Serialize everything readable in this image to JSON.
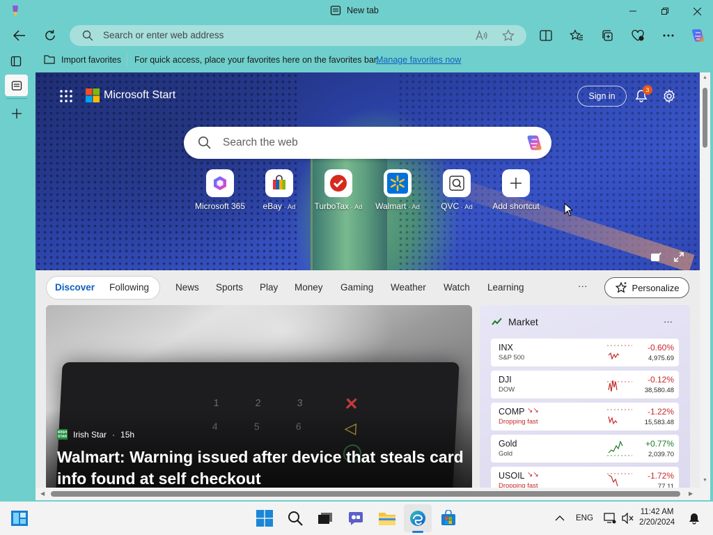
{
  "window": {
    "tab_title": "New tab"
  },
  "address_bar": {
    "placeholder": "Search or enter web address"
  },
  "favorites_bar": {
    "import_label": "Import favorites",
    "message": "For quick access, place your favorites here on the favorites bar.",
    "manage_link": "Manage favorites now"
  },
  "header": {
    "brand": "Microsoft Start",
    "sign_in": "Sign in",
    "notification_count": "3"
  },
  "search": {
    "placeholder": "Search the web"
  },
  "shortcuts": [
    {
      "label": "Microsoft 365",
      "ad": ""
    },
    {
      "label": "eBay",
      "ad": " · Ad"
    },
    {
      "label": "TurboTax",
      "ad": " · Ad"
    },
    {
      "label": "Walmart",
      "ad": " · Ad"
    },
    {
      "label": "QVC",
      "ad": " · Ad"
    },
    {
      "label": "Add shortcut",
      "ad": ""
    }
  ],
  "feed_nav": {
    "tabs": [
      "Discover",
      "Following",
      "News",
      "Sports",
      "Play",
      "Money",
      "Gaming",
      "Weather",
      "Watch",
      "Learning"
    ],
    "more": "···",
    "personalize": "Personalize"
  },
  "hero_card": {
    "source": "Irish Star",
    "age": "15h",
    "source_logo_text": "IRISH STAR",
    "headline": "Walmart: Warning issued after device that steals card info found at self checkout"
  },
  "market": {
    "title": "Market",
    "more": "···",
    "items": [
      {
        "ticker": "INX",
        "name": "S&P 500",
        "change": "-0.60%",
        "price": "4,975.69",
        "trend": "down",
        "alert": false
      },
      {
        "ticker": "DJI",
        "name": "DOW",
        "change": "-0.12%",
        "price": "38,580.48",
        "trend": "down",
        "alert": false
      },
      {
        "ticker": "COMP",
        "name": "Dropping fast",
        "change": "-1.22%",
        "price": "15,583.48",
        "trend": "down",
        "alert": true
      },
      {
        "ticker": "Gold",
        "name": "Gold",
        "change": "+0.77%",
        "price": "2,039.70",
        "trend": "up",
        "alert": false
      },
      {
        "ticker": "USOIL",
        "name": "Dropping fast",
        "change": "-1.72%",
        "price": "77.11",
        "trend": "down",
        "alert": true
      }
    ]
  },
  "taskbar": {
    "language": "ENG",
    "time": "11:42 AM",
    "date": "2/20/2024"
  },
  "colors": {
    "accent_link": "#0f5fbf",
    "negative": "#c62828",
    "positive": "#1b7a24",
    "notification_badge": "#e25a1c"
  }
}
